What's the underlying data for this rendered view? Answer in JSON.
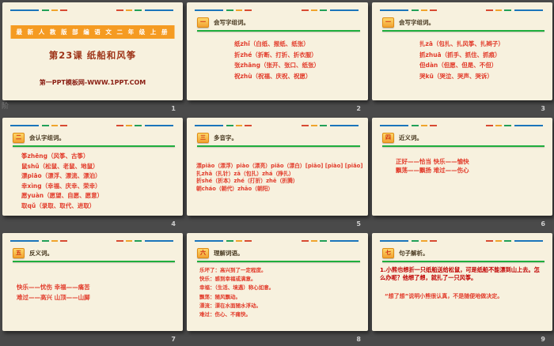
{
  "colors": {
    "canvas_bg": "#4a4a4a",
    "slide_bg": "#f7f1de",
    "accent_orange": "#f59b22",
    "content_red": "#e23b2a",
    "dark_red": "#c00000",
    "title_maroon": "#9e3418",
    "green_underline": "#1fae3d",
    "decor_blue": "#1b75bb",
    "decor_green": "#21a058",
    "decor_yellow": "#f0a42c",
    "decor_red": "#d84a32"
  },
  "watermark": "阶",
  "slides": [
    {
      "page_number": "1",
      "banner": "最 新 人 教 版 部 编 语 文 二 年 级 上 册",
      "title": "第23课  纸船和风筝",
      "footer": "第一PPT模板网-WWW.1PPT.COM"
    },
    {
      "page_number": "2",
      "icon": "一",
      "header": "会写字组词。",
      "lines": [
        "纸zhǐ（白纸、报纸、纸张）",
        "折zhé（折断、打折、折衣服）",
        "张zhāng（张开、张口、纸张）",
        "祝zhù（祝福、庆祝、祝愿）"
      ]
    },
    {
      "page_number": "3",
      "icon": "一",
      "header": "会写字组词。",
      "lines": [
        "扎zā（包扎、扎风筝、扎辫子）",
        "抓zhuā（抓手、抓住、抓痕）",
        "但dàn（但愿、但是、不但）",
        "哭kū（哭泣、哭声、哭诉）"
      ]
    },
    {
      "page_number": "4",
      "icon": "二",
      "header": "会认字组词。",
      "lines": [
        "筝zhēng（风筝、古筝）",
        "鼠shǔ（松鼠、老鼠、地鼠）",
        "漂piāo（漂浮、漂流、漂泊）",
        "幸xìng（幸福、庆幸、荣幸）",
        "愿yuàn（愿望、自愿、愿意）",
        "取qǔ（录取、取代、进取）"
      ]
    },
    {
      "page_number": "5",
      "icon": "三",
      "header": "多音字。",
      "lines": [
        "漂piāo（漂浮）piào（漂亮）piǎo（漂白）[piāo] [piào] [piǎo]",
        "扎zhā（扎针）zā（包扎）zhá（挣扎）",
        "折shé（折本）zhé（打折）zhē（折腾）",
        "朝cháo（朝代）zhāo（朝阳）"
      ]
    },
    {
      "page_number": "6",
      "icon": "四",
      "header": "近义词。",
      "lines": [
        "正好——恰当 快乐——愉快",
        "飘荡——飘扬 难过——伤心"
      ]
    },
    {
      "page_number": "7",
      "icon": "五",
      "header": "反义词。",
      "lines": [
        "快乐——忧伤 幸福——痛苦",
        "难过——高兴 山顶——山脚"
      ]
    },
    {
      "page_number": "8",
      "icon": "六",
      "header": "理解词语。",
      "lines": [
        "乐坏了：高兴到了一定程度。",
        "快乐：感到幸福或满意。",
        "幸福：（生活、境遇）称心如意。",
        "飘荡：随风飘动。",
        "漂流：漂在水面随水浮动。",
        "难过：伤心、不痛快。"
      ]
    },
    {
      "page_number": "9",
      "icon": "七",
      "header": "句子解析。",
      "sentence": "1.小熊也想折一只纸船送给松鼠，可是纸船不能漂到山上去。怎么办呢？他想了想，就扎了一只风筝。",
      "analysis": "“想了想”说明小熊很认真，不是随便地做决定。"
    }
  ]
}
